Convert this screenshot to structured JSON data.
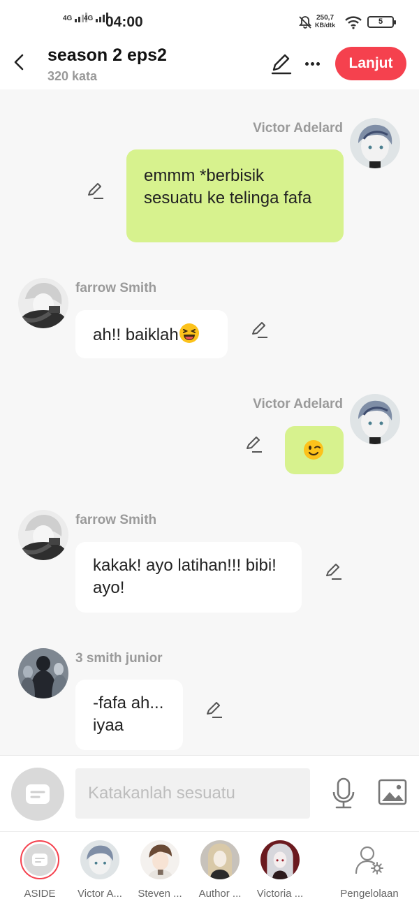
{
  "status": {
    "net1": "4G",
    "net2": "4G",
    "time": "04:00",
    "speed_value": "250,7",
    "speed_unit": "KB/dtk",
    "battery": "5"
  },
  "header": {
    "title": "season 2 eps2",
    "word_count": "320 kata",
    "next_label": "Lanjut"
  },
  "messages": [
    {
      "sender": "Victor Adelard",
      "side": "right",
      "text": "emmm *berbisik sesuatu ke telinga fafa"
    },
    {
      "sender": "farrow Smith",
      "side": "left",
      "text": "ah!! baiklah",
      "emoji": "laughing-face"
    },
    {
      "sender": "Victor Adelard",
      "side": "right",
      "text": "",
      "emoji": "winking-face"
    },
    {
      "sender": "farrow Smith",
      "side": "left",
      "text": "kakak! ayo latihan!!! bibi! ayo!"
    },
    {
      "sender": "3 smith junior",
      "side": "left",
      "text": "-fafa ah... iyaa"
    }
  ],
  "input": {
    "placeholder": "Katakanlah sesuatu"
  },
  "characters": [
    {
      "label": "ASIDE"
    },
    {
      "label": "Victor A..."
    },
    {
      "label": "Steven ..."
    },
    {
      "label": "Author ..."
    },
    {
      "label": "Victoria ..."
    },
    {
      "label": "Pengelolaan"
    }
  ],
  "colors": {
    "accent": "#f5414e",
    "bubble_self": "#d7f28e",
    "bubble_other": "#ffffff",
    "background": "#f7f7f7"
  }
}
